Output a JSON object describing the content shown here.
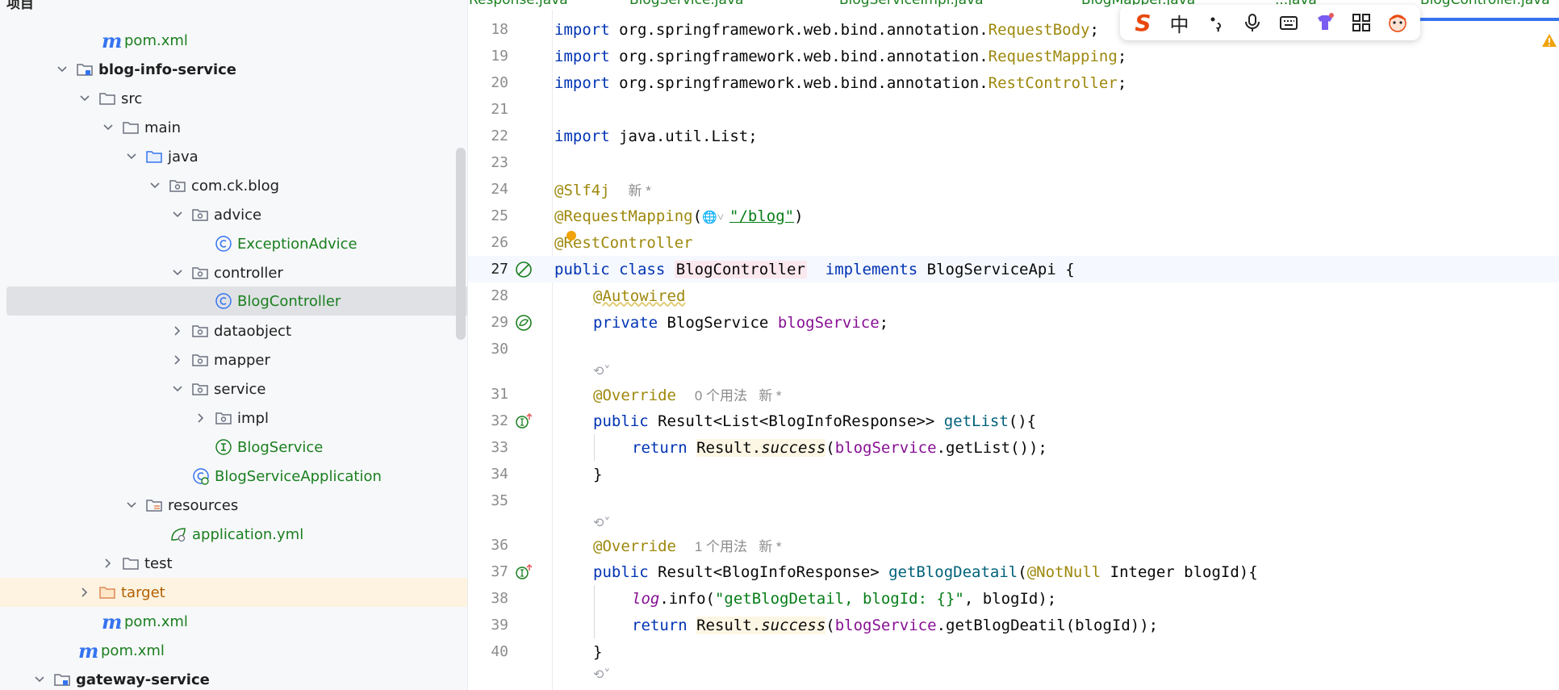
{
  "tree": {
    "header": "项目",
    "items": [
      {
        "label": "pom.xml",
        "icon": "maven-icon",
        "expander": "none"
      },
      {
        "label": "blog-info-service",
        "icon": "module-folder-icon",
        "expander": "expanded"
      },
      {
        "label": "src",
        "icon": "folder-icon",
        "expander": "expanded"
      },
      {
        "label": "main",
        "icon": "folder-icon",
        "expander": "expanded"
      },
      {
        "label": "java",
        "icon": "source-folder-icon",
        "expander": "expanded"
      },
      {
        "label": "com.ck.blog",
        "icon": "package-icon",
        "expander": "expanded"
      },
      {
        "label": "advice",
        "icon": "package-icon",
        "expander": "expanded"
      },
      {
        "label": "ExceptionAdvice",
        "icon": "class-icon",
        "expander": "none"
      },
      {
        "label": "controller",
        "icon": "package-icon",
        "expander": "expanded"
      },
      {
        "label": "BlogController",
        "icon": "class-icon",
        "expander": "none"
      },
      {
        "label": "dataobject",
        "icon": "package-icon",
        "expander": "collapsed"
      },
      {
        "label": "mapper",
        "icon": "package-icon",
        "expander": "collapsed"
      },
      {
        "label": "service",
        "icon": "package-icon",
        "expander": "expanded"
      },
      {
        "label": "impl",
        "icon": "package-icon",
        "expander": "collapsed"
      },
      {
        "label": "BlogService",
        "icon": "interface-icon",
        "expander": "none"
      },
      {
        "label": "BlogServiceApplication",
        "icon": "spring-boot-class-icon",
        "expander": "none"
      },
      {
        "label": "resources",
        "icon": "resources-folder-icon",
        "expander": "expanded"
      },
      {
        "label": "application.yml",
        "icon": "spring-config-icon",
        "expander": "none"
      },
      {
        "label": "test",
        "icon": "folder-icon",
        "expander": "collapsed"
      },
      {
        "label": "target",
        "icon": "excluded-folder-icon",
        "expander": "collapsed"
      },
      {
        "label": "pom.xml",
        "icon": "maven-icon",
        "expander": "none"
      },
      {
        "label": "pom.xml",
        "icon": "maven-icon",
        "expander": "none"
      },
      {
        "label": "gateway-service",
        "icon": "module-folder-icon",
        "expander": "expanded"
      }
    ]
  },
  "tabs": [
    {
      "label": "Response.java"
    },
    {
      "label": "BlogService.java"
    },
    {
      "label": "BlogServiceImpl.java"
    },
    {
      "label": "BlogMapper.java"
    },
    {
      "label": "...java"
    },
    {
      "label": "BlogController.java"
    }
  ],
  "ime": {
    "logo": "S",
    "chinese_mode": "中",
    "items": [
      "punctuation-icon",
      "microphone-icon",
      "keyboard-icon",
      "skin-icon",
      "apps-grid-icon",
      "mascot-icon"
    ]
  },
  "editor": {
    "lines": [
      {
        "num": "18",
        "text": "import org.springframework.web.bind.annotation.RequestBody;"
      },
      {
        "num": "19",
        "text": "import org.springframework.web.bind.annotation.RequestMapping;"
      },
      {
        "num": "20",
        "text": "import org.springframework.web.bind.annotation.RestController;"
      },
      {
        "num": "21",
        "text": ""
      },
      {
        "num": "22",
        "text": "import java.util.List;"
      },
      {
        "num": "23",
        "text": ""
      },
      {
        "num": "24",
        "text": "@Slf4j",
        "hint": "新 *"
      },
      {
        "num": "25",
        "text": "@RequestMapping(\"/blog\")"
      },
      {
        "num": "26",
        "text": "@RestController"
      },
      {
        "num": "27",
        "text": "public class BlogController  implements BlogServiceApi {"
      },
      {
        "num": "28",
        "text": "@Autowired"
      },
      {
        "num": "29",
        "text": "private BlogService blogService;"
      },
      {
        "num": "30",
        "text": ""
      },
      {
        "num": "31",
        "text": "@Override",
        "hint": "0 个用法   新 *"
      },
      {
        "num": "32",
        "text": "public Result<List<BlogInfoResponse>> getList(){"
      },
      {
        "num": "33",
        "text": "return Result.success(blogService.getList());"
      },
      {
        "num": "34",
        "text": "}"
      },
      {
        "num": "35",
        "text": ""
      },
      {
        "num": "36",
        "text": "@Override",
        "hint": "1 个用法   新 *"
      },
      {
        "num": "37",
        "text": "public Result<BlogInfoResponse> getBlogDeatail(@NotNull Integer blogId){"
      },
      {
        "num": "38",
        "text": "log.info(\"getBlogDetail, blogId: {}\", blogId);"
      },
      {
        "num": "39",
        "text": "return Result.success(blogService.getBlogDeatil(blogId));"
      },
      {
        "num": "40",
        "text": "}"
      }
    ],
    "tokens": {
      "import": "import",
      "pkg18": "org.springframework.web.bind.annotation.",
      "RequestBody": "RequestBody",
      "RequestMapping": "RequestMapping",
      "RestController": "RestController",
      "semi": ";",
      "javaUtilList": "java.util.List",
      "slf4j": "@Slf4j",
      "reqMappingAnn": "@RequestMapping",
      "blogPath": "\"/blog\"",
      "restControllerAnn": "@RestController",
      "public": "public",
      "class": "class",
      "BlogController": "BlogController",
      "implements": "implements",
      "BlogServiceApi": "BlogServiceApi {",
      "autowired": "@Autowired",
      "private": "private",
      "BlogService": "BlogService ",
      "blogService": "blogService",
      "override": "@Override",
      "resultListType": "Result<List<BlogInfoResponse>> ",
      "getList": "getList",
      "getListTail": "(){",
      "return": "return",
      "Result": "Result",
      "success": "success",
      "getListCall": ".getList());",
      "closeBrace": "}",
      "resultType": "Result<BlogInfoResponse> ",
      "getBlogDeatail": "getBlogDeatail",
      "notNull": "@NotNull",
      "integerBlogId": " Integer blogId){",
      "log": "log",
      "infoCall": ".info(",
      "logStr": "\"getBlogDetail, blogId: {}\"",
      "logTail": ", blogId);",
      "getBlogDeatil": ".getBlogDeatil(blogId));"
    }
  },
  "colors": {
    "keyword": "#0033b3",
    "annotation": "#9e880d",
    "string": "#067d17",
    "field": "#871094",
    "method": "#00627a",
    "tab_indicator": "#3574f0",
    "selection": "#dfe1e5",
    "excluded_folder_bg": "#fdf3e0"
  }
}
